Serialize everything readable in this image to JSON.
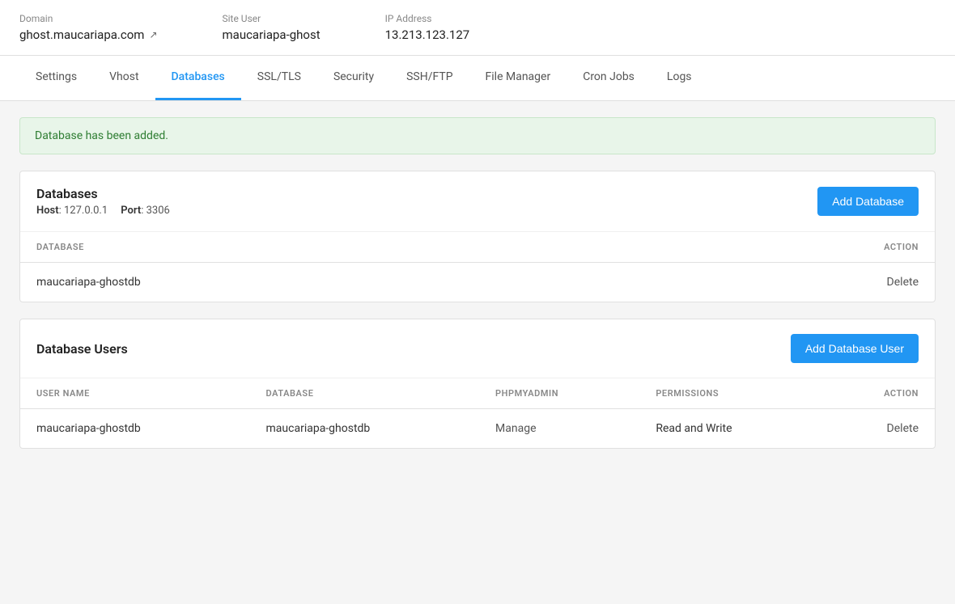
{
  "topbar": {
    "domain_label": "Domain",
    "domain_value": "ghost.maucariapa.com",
    "site_user_label": "Site User",
    "site_user_value": "maucariapa-ghost",
    "ip_address_label": "IP Address",
    "ip_address_value": "13.213.123.127"
  },
  "tabs": [
    {
      "id": "settings",
      "label": "Settings",
      "active": false
    },
    {
      "id": "vhost",
      "label": "Vhost",
      "active": false
    },
    {
      "id": "databases",
      "label": "Databases",
      "active": true
    },
    {
      "id": "ssl-tls",
      "label": "SSL/TLS",
      "active": false
    },
    {
      "id": "security",
      "label": "Security",
      "active": false
    },
    {
      "id": "ssh-ftp",
      "label": "SSH/FTP",
      "active": false
    },
    {
      "id": "file-manager",
      "label": "File Manager",
      "active": false
    },
    {
      "id": "cron-jobs",
      "label": "Cron Jobs",
      "active": false
    },
    {
      "id": "logs",
      "label": "Logs",
      "active": false
    }
  ],
  "alert": {
    "message": "Database has been added."
  },
  "databases_card": {
    "title": "Databases",
    "host_label": "Host",
    "host_value": "127.0.0.1",
    "port_label": "Port",
    "port_value": "3306",
    "add_button": "Add Database",
    "columns": {
      "database": "DATABASE",
      "action": "ACTION"
    },
    "rows": [
      {
        "database": "maucariapa-ghostdb",
        "action": "Delete"
      }
    ]
  },
  "database_users_card": {
    "title": "Database Users",
    "add_button": "Add Database User",
    "columns": {
      "user_name": "USER NAME",
      "database": "DATABASE",
      "phpmyadmin": "PHPMYADMIN",
      "permissions": "PERMISSIONS",
      "action": "ACTION"
    },
    "rows": [
      {
        "user_name": "maucariapa-ghostdb",
        "database": "maucariapa-ghostdb",
        "phpmyadmin": "Manage",
        "permissions": "Read and Write",
        "action": "Delete"
      }
    ]
  }
}
